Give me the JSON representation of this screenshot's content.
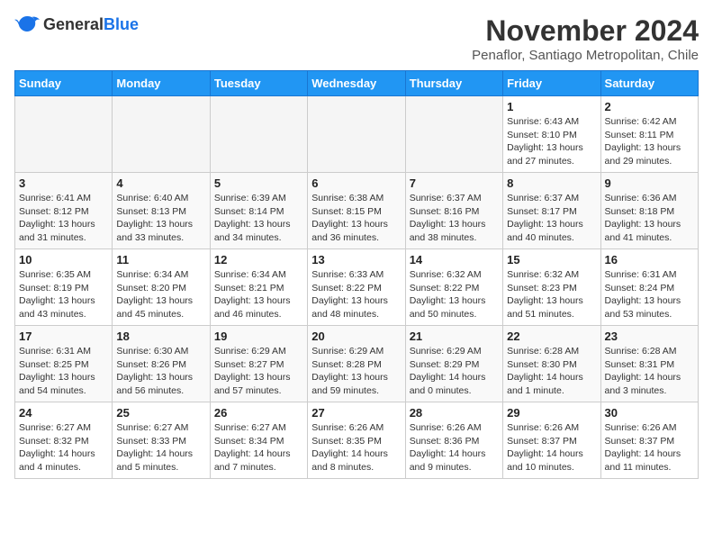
{
  "logo": {
    "general": "General",
    "blue": "Blue"
  },
  "title": "November 2024",
  "subtitle": "Penaflor, Santiago Metropolitan, Chile",
  "weekdays": [
    "Sunday",
    "Monday",
    "Tuesday",
    "Wednesday",
    "Thursday",
    "Friday",
    "Saturday"
  ],
  "weeks": [
    [
      {
        "day": "",
        "info": ""
      },
      {
        "day": "",
        "info": ""
      },
      {
        "day": "",
        "info": ""
      },
      {
        "day": "",
        "info": ""
      },
      {
        "day": "",
        "info": ""
      },
      {
        "day": "1",
        "info": "Sunrise: 6:43 AM\nSunset: 8:10 PM\nDaylight: 13 hours\nand 27 minutes."
      },
      {
        "day": "2",
        "info": "Sunrise: 6:42 AM\nSunset: 8:11 PM\nDaylight: 13 hours\nand 29 minutes."
      }
    ],
    [
      {
        "day": "3",
        "info": "Sunrise: 6:41 AM\nSunset: 8:12 PM\nDaylight: 13 hours\nand 31 minutes."
      },
      {
        "day": "4",
        "info": "Sunrise: 6:40 AM\nSunset: 8:13 PM\nDaylight: 13 hours\nand 33 minutes."
      },
      {
        "day": "5",
        "info": "Sunrise: 6:39 AM\nSunset: 8:14 PM\nDaylight: 13 hours\nand 34 minutes."
      },
      {
        "day": "6",
        "info": "Sunrise: 6:38 AM\nSunset: 8:15 PM\nDaylight: 13 hours\nand 36 minutes."
      },
      {
        "day": "7",
        "info": "Sunrise: 6:37 AM\nSunset: 8:16 PM\nDaylight: 13 hours\nand 38 minutes."
      },
      {
        "day": "8",
        "info": "Sunrise: 6:37 AM\nSunset: 8:17 PM\nDaylight: 13 hours\nand 40 minutes."
      },
      {
        "day": "9",
        "info": "Sunrise: 6:36 AM\nSunset: 8:18 PM\nDaylight: 13 hours\nand 41 minutes."
      }
    ],
    [
      {
        "day": "10",
        "info": "Sunrise: 6:35 AM\nSunset: 8:19 PM\nDaylight: 13 hours\nand 43 minutes."
      },
      {
        "day": "11",
        "info": "Sunrise: 6:34 AM\nSunset: 8:20 PM\nDaylight: 13 hours\nand 45 minutes."
      },
      {
        "day": "12",
        "info": "Sunrise: 6:34 AM\nSunset: 8:21 PM\nDaylight: 13 hours\nand 46 minutes."
      },
      {
        "day": "13",
        "info": "Sunrise: 6:33 AM\nSunset: 8:22 PM\nDaylight: 13 hours\nand 48 minutes."
      },
      {
        "day": "14",
        "info": "Sunrise: 6:32 AM\nSunset: 8:22 PM\nDaylight: 13 hours\nand 50 minutes."
      },
      {
        "day": "15",
        "info": "Sunrise: 6:32 AM\nSunset: 8:23 PM\nDaylight: 13 hours\nand 51 minutes."
      },
      {
        "day": "16",
        "info": "Sunrise: 6:31 AM\nSunset: 8:24 PM\nDaylight: 13 hours\nand 53 minutes."
      }
    ],
    [
      {
        "day": "17",
        "info": "Sunrise: 6:31 AM\nSunset: 8:25 PM\nDaylight: 13 hours\nand 54 minutes."
      },
      {
        "day": "18",
        "info": "Sunrise: 6:30 AM\nSunset: 8:26 PM\nDaylight: 13 hours\nand 56 minutes."
      },
      {
        "day": "19",
        "info": "Sunrise: 6:29 AM\nSunset: 8:27 PM\nDaylight: 13 hours\nand 57 minutes."
      },
      {
        "day": "20",
        "info": "Sunrise: 6:29 AM\nSunset: 8:28 PM\nDaylight: 13 hours\nand 59 minutes."
      },
      {
        "day": "21",
        "info": "Sunrise: 6:29 AM\nSunset: 8:29 PM\nDaylight: 14 hours\nand 0 minutes."
      },
      {
        "day": "22",
        "info": "Sunrise: 6:28 AM\nSunset: 8:30 PM\nDaylight: 14 hours\nand 1 minute."
      },
      {
        "day": "23",
        "info": "Sunrise: 6:28 AM\nSunset: 8:31 PM\nDaylight: 14 hours\nand 3 minutes."
      }
    ],
    [
      {
        "day": "24",
        "info": "Sunrise: 6:27 AM\nSunset: 8:32 PM\nDaylight: 14 hours\nand 4 minutes."
      },
      {
        "day": "25",
        "info": "Sunrise: 6:27 AM\nSunset: 8:33 PM\nDaylight: 14 hours\nand 5 minutes."
      },
      {
        "day": "26",
        "info": "Sunrise: 6:27 AM\nSunset: 8:34 PM\nDaylight: 14 hours\nand 7 minutes."
      },
      {
        "day": "27",
        "info": "Sunrise: 6:26 AM\nSunset: 8:35 PM\nDaylight: 14 hours\nand 8 minutes."
      },
      {
        "day": "28",
        "info": "Sunrise: 6:26 AM\nSunset: 8:36 PM\nDaylight: 14 hours\nand 9 minutes."
      },
      {
        "day": "29",
        "info": "Sunrise: 6:26 AM\nSunset: 8:37 PM\nDaylight: 14 hours\nand 10 minutes."
      },
      {
        "day": "30",
        "info": "Sunrise: 6:26 AM\nSunset: 8:37 PM\nDaylight: 14 hours\nand 11 minutes."
      }
    ]
  ]
}
